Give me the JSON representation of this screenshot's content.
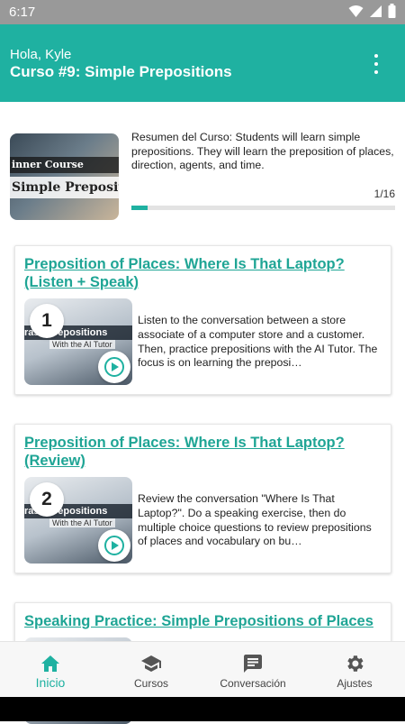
{
  "status_bar": {
    "time": "6:17"
  },
  "header": {
    "greeting": "Hola, Kyle",
    "title": "Curso #9: Simple Prepositions"
  },
  "course": {
    "thumb_line1": "inner Course",
    "thumb_line2": "Simple Preposit",
    "summary": "Resumen del Curso: Students will learn simple prepositions. They will learn the preposition of places, direction, agents, and time.",
    "progress_label": "1/16",
    "progress_fraction": 0.0625
  },
  "lessons": [
    {
      "number": "1",
      "title": "Preposition of Places: Where Is That Laptop? (Listen + Speak)",
      "thumb_band": "rase Prepositions",
      "thumb_sub": "With the AI Tutor",
      "description": "Listen to the conversation between a store associate of a computer store and a customer. Then, practice prepositions with the AI Tutor. The focus is on learning the preposi…"
    },
    {
      "number": "2",
      "title": "Preposition of Places: Where Is That Laptop? (Review)",
      "thumb_band": "rase Prepositions",
      "thumb_sub": "With the AI Tutor",
      "description": "Review the conversation \"Where Is That Laptop?\". Do a speaking exercise, then do multiple choice questions to review prepositions of places and vocabulary on bu…"
    },
    {
      "title": "Speaking Practice: Simple Prepositions of Places"
    }
  ],
  "bottom_nav": [
    {
      "label": "Inicio",
      "icon": "home-icon",
      "active": true
    },
    {
      "label": "Cursos",
      "icon": "school-icon",
      "active": false
    },
    {
      "label": "Conversación",
      "icon": "chat-icon",
      "active": false
    },
    {
      "label": "Ajustes",
      "icon": "gear-icon",
      "active": false
    }
  ],
  "colors": {
    "accent": "#1fb1a1",
    "link": "#1fa595"
  }
}
